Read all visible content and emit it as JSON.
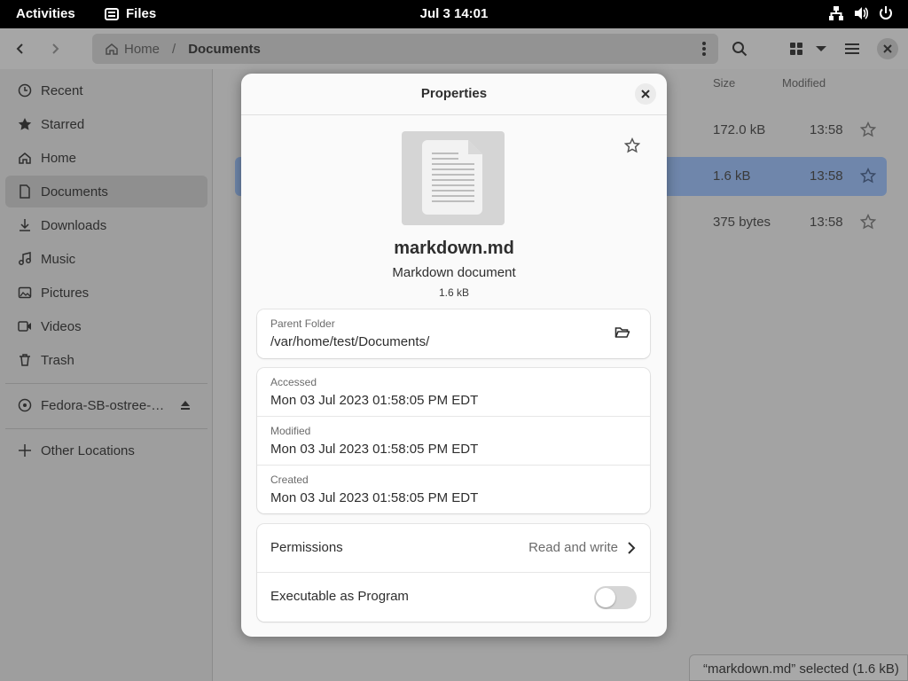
{
  "topbar": {
    "activities": "Activities",
    "app_name": "Files",
    "clock": "Jul 3  14:01"
  },
  "headerbar": {
    "path": {
      "home": "Home",
      "current": "Documents"
    }
  },
  "sidebar": {
    "items": [
      {
        "label": "Recent",
        "icon": "clock-icon"
      },
      {
        "label": "Starred",
        "icon": "star-icon"
      },
      {
        "label": "Home",
        "icon": "home-icon"
      },
      {
        "label": "Documents",
        "icon": "document-icon",
        "active": true
      },
      {
        "label": "Downloads",
        "icon": "download-icon"
      },
      {
        "label": "Music",
        "icon": "music-icon"
      },
      {
        "label": "Pictures",
        "icon": "picture-icon"
      },
      {
        "label": "Videos",
        "icon": "video-icon"
      },
      {
        "label": "Trash",
        "icon": "trash-icon"
      }
    ],
    "drive": {
      "label": "Fedora-SB-ostree-…",
      "icon": "disc-icon"
    },
    "other": {
      "label": "Other Locations",
      "icon": "plus-icon"
    }
  },
  "file_list": {
    "columns": {
      "size": "Size",
      "modified": "Modified"
    },
    "rows": [
      {
        "size": "172.0 kB",
        "modified": "13:58",
        "selected": false
      },
      {
        "size": "1.6 kB",
        "modified": "13:58",
        "selected": true
      },
      {
        "size": "375 bytes",
        "modified": "13:58",
        "selected": false
      }
    ]
  },
  "statusbar": "“markdown.md” selected  (1.6 kB)",
  "dialog": {
    "title": "Properties",
    "file_name": "markdown.md",
    "file_type": "Markdown document",
    "file_size": "1.6 kB",
    "parent_folder": {
      "label": "Parent Folder",
      "value": "/var/home/test/Documents/"
    },
    "times": [
      {
        "label": "Accessed",
        "value": "Mon 03 Jul 2023 01:58:05 PM EDT"
      },
      {
        "label": "Modified",
        "value": "Mon 03 Jul 2023 01:58:05 PM EDT"
      },
      {
        "label": "Created",
        "value": "Mon 03 Jul 2023 01:58:05 PM EDT"
      }
    ],
    "permissions": {
      "label": "Permissions",
      "value": "Read and write"
    },
    "executable": {
      "label": "Executable as Program",
      "enabled": false
    }
  },
  "colors": {
    "selection": "#6f86ab",
    "dialog_bg": "#fafafa",
    "topbar": "#000000"
  }
}
